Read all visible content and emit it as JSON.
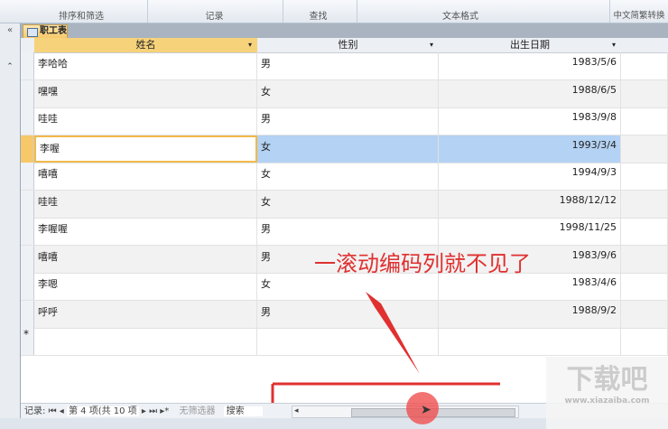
{
  "ribbon": {
    "groups": [
      "排序和筛选",
      "记录",
      "查找",
      "文本格式",
      "中文简繁转换"
    ]
  },
  "tab": {
    "label": "职工表"
  },
  "columns": [
    "姓名",
    "性别",
    "出生日期"
  ],
  "rows": [
    [
      "李哈哈",
      "男",
      "1983/5/6"
    ],
    [
      "嘿嘿",
      "女",
      "1988/6/5"
    ],
    [
      "哇哇",
      "男",
      "1983/9/8"
    ],
    [
      "李喔",
      "女",
      "1993/3/4"
    ],
    [
      "嘻嘻",
      "女",
      "1994/9/3"
    ],
    [
      "哇哇",
      "女",
      "1988/12/12"
    ],
    [
      "李喔喔",
      "男",
      "1998/11/25"
    ],
    [
      "嘻嘻",
      "男",
      "1983/9/6"
    ],
    [
      "李嗯",
      "女",
      "1983/4/6"
    ],
    [
      "呼呼",
      "男",
      "1988/9/2"
    ]
  ],
  "new_row_marker": "*",
  "status": {
    "label": "记录:",
    "position": "第 4 项(共 10 项",
    "filter": "无筛选器",
    "search": "搜索"
  },
  "annotation": "一滚动编码列就不见了",
  "watermark": "下载吧 www.xiazaiba.com",
  "colors": {
    "accent": "#e03030",
    "selection": "#b4d2f3",
    "header_active": "#f6c86a"
  }
}
